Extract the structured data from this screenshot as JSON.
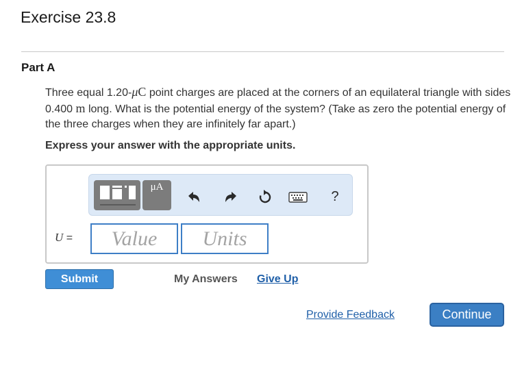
{
  "header": {
    "title": "Exercise 23.8"
  },
  "part": {
    "label": "Part A"
  },
  "question": {
    "t1": "Three equal 1.20-",
    "charge_unit_prefix": "μ",
    "charge_unit": "C",
    "t2": " point charges are placed at the corners of an equilateral triangle with sides 0.400 ",
    "length_unit": "m",
    "t3": " long. What is the potential energy of the system? (Take as zero the potential energy of the three charges when they are infinitely far apart.)"
  },
  "instruction": "Express your answer with the appropriate units.",
  "toolbar": {
    "units_button_label": "μA",
    "help_label": "?",
    "icons": [
      "templates-icon",
      "units-icon",
      "undo-icon",
      "redo-icon",
      "reset-icon",
      "keyboard-icon",
      "help-icon"
    ]
  },
  "answer": {
    "variable": "U",
    "equals": "=",
    "value_placeholder": "Value",
    "units_placeholder": "Units"
  },
  "actions": {
    "submit": "Submit",
    "my_answers": "My Answers",
    "give_up": "Give Up",
    "provide_feedback": "Provide Feedback",
    "continue": "Continue"
  },
  "colors": {
    "link": "#1f5fa8",
    "button": "#3f8ed6",
    "field_border": "#3d7ec6",
    "toolbar_bg": "#dde9f7"
  }
}
